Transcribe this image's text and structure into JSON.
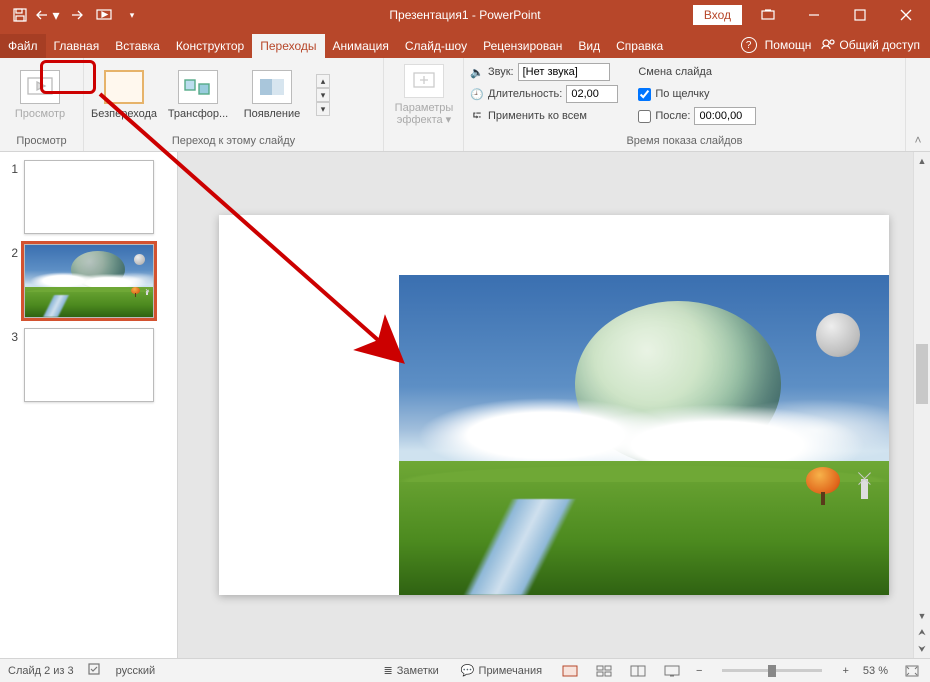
{
  "title": "Презентация1  -  PowerPoint",
  "login": "Вход",
  "tabs": {
    "file": "Файл",
    "home": "Главная",
    "insert": "Вставка",
    "design": "Конструктор",
    "transitions": "Переходы",
    "animations": "Анимация",
    "slideshow": "Слайд-шоу",
    "review": "Рецензирован",
    "view": "Вид",
    "help": "Справка"
  },
  "tabs_right": {
    "tell_me": "Помощн",
    "share": "Общий доступ"
  },
  "ribbon": {
    "preview_group": "Просмотр",
    "preview_btn": "Просмотр",
    "transition_group": "Переход к этому слайду",
    "none": "Безперехода",
    "morph": "Трансфор...",
    "fade": "Появление",
    "effect_options": "Параметры эффекта ▾",
    "timing_group": "Время показа слайдов",
    "sound_label": "Звук:",
    "sound_value": "[Нет звука]",
    "duration_label": "Длительность:",
    "duration_value": "02,00",
    "apply_all": "Применить ко всем",
    "advance_title": "Смена слайда",
    "on_click": "По щелчку",
    "after": "После:",
    "after_value": "00:00,00"
  },
  "slides": [
    {
      "num": "1"
    },
    {
      "num": "2"
    },
    {
      "num": "3"
    }
  ],
  "status": {
    "slide_of": "Слайд 2 из 3",
    "lang": "русский",
    "notes": "Заметки",
    "comments": "Примечания",
    "zoom": "53 %"
  }
}
